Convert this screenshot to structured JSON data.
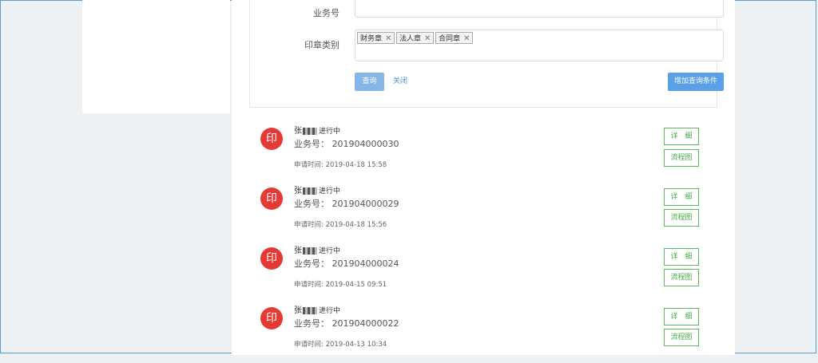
{
  "form": {
    "biz_label": "业务号",
    "seal_type_label": "印章类别",
    "tags": [
      {
        "label": "财务章",
        "remove": "✕"
      },
      {
        "label": "法人章",
        "remove": "✕"
      },
      {
        "label": "合同章",
        "remove": "✕"
      }
    ],
    "query_button": "查询",
    "close_link": "关闭",
    "add_condition_button": "增加查询条件"
  },
  "list": {
    "seal_char": "印",
    "items": [
      {
        "name": "张",
        "status": "进行中",
        "biz_no": "业务号：  201904000030",
        "time": "申请时间: 2019-04-18 15:58",
        "detail": "详　细",
        "flow": "流程图"
      },
      {
        "name": "张",
        "status": "进行中",
        "biz_no": "业务号：  201904000029",
        "time": "申请时间: 2019-04-18 15:56",
        "detail": "详　细",
        "flow": "流程图"
      },
      {
        "name": "张",
        "status": "进行中",
        "biz_no": "业务号：  201904000024",
        "time": "申请时间: 2019-04-15 09:51",
        "detail": "详　细",
        "flow": "流程图"
      },
      {
        "name": "张",
        "status": "进行中",
        "biz_no": "业务号：  201904000022",
        "time": "申请时间: 2019-04-13 10:34",
        "detail": "详　细",
        "flow": "流程图"
      }
    ]
  },
  "colors": {
    "seal": "#e53935",
    "primary": "#5aa0e6",
    "success": "#5cb85c",
    "frame": "#5b9bd5"
  }
}
